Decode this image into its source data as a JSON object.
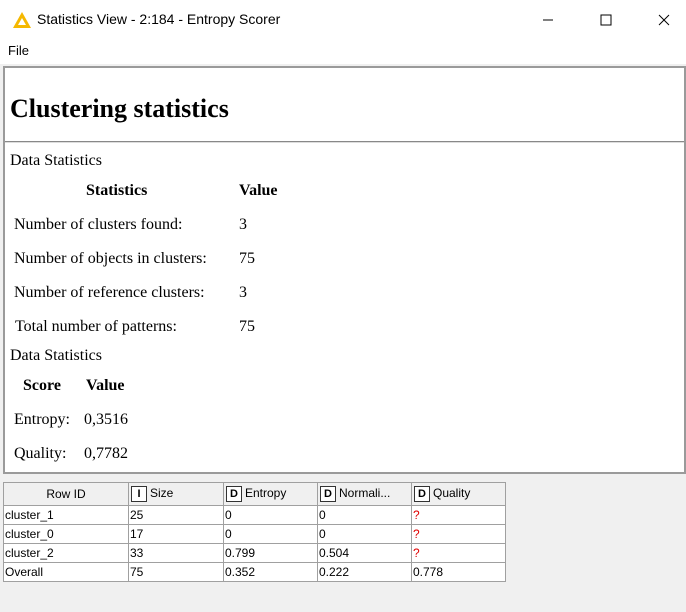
{
  "window": {
    "title": "Statistics View - 2:184 - Entropy Scorer",
    "controls": {
      "minimize": "─",
      "maximize": "☐",
      "close": "✕"
    }
  },
  "menu": {
    "file": "File"
  },
  "report": {
    "heading": "Clustering statistics",
    "data_stats": {
      "label": "Data Statistics",
      "header_stat": "Statistics",
      "header_value": "Value",
      "rows": [
        {
          "name": "Number of clusters found:",
          "value": "3"
        },
        {
          "name": "Number of objects in clusters:",
          "value": "75"
        },
        {
          "name": "Number of reference clusters:",
          "value": "3"
        },
        {
          "name": "Total number of patterns:",
          "value": "75"
        }
      ]
    },
    "score_stats": {
      "label": "Data Statistics",
      "header_score": "Score",
      "header_value": "Value",
      "rows": [
        {
          "name": "Entropy:",
          "value": "0,3516"
        },
        {
          "name": "Quality:",
          "value": "0,7782"
        }
      ]
    }
  },
  "table": {
    "columns": [
      {
        "label": "Row ID",
        "type": ""
      },
      {
        "label": "Size",
        "type": "I"
      },
      {
        "label": "Entropy",
        "type": "D"
      },
      {
        "label": "Normali...",
        "type": "D"
      },
      {
        "label": "Quality",
        "type": "D"
      }
    ],
    "rows": [
      {
        "id": "cluster_1",
        "size": "25",
        "entropy": "0",
        "normalized": "0",
        "quality": "?"
      },
      {
        "id": "cluster_0",
        "size": "17",
        "entropy": "0",
        "normalized": "0",
        "quality": "?"
      },
      {
        "id": "cluster_2",
        "size": "33",
        "entropy": "0.799",
        "normalized": "0.504",
        "quality": "?"
      },
      {
        "id": "Overall",
        "size": "75",
        "entropy": "0.352",
        "normalized": "0.222",
        "quality": "0.778"
      }
    ]
  },
  "colors": {
    "missing_value": "#e00000",
    "warning_icon": "#f5b800"
  }
}
